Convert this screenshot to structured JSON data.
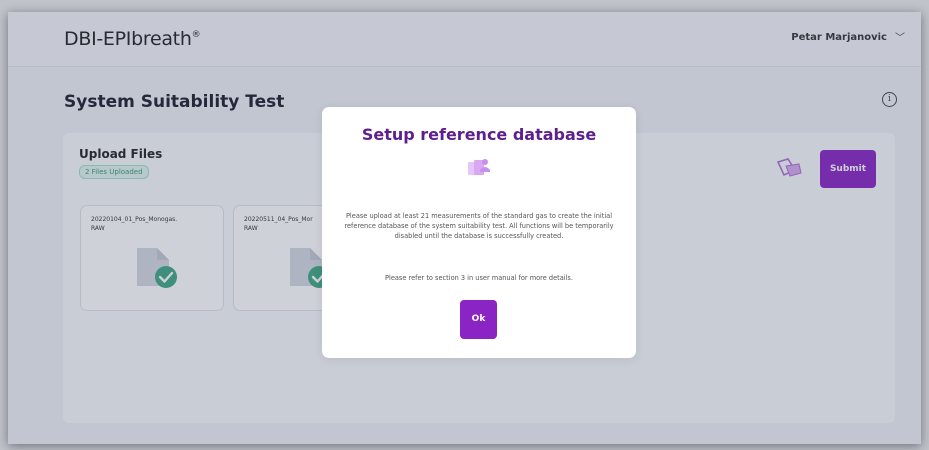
{
  "header": {
    "logo": "DBI-EPIbreath",
    "logo_mark": "®",
    "user_name": "Petar Marjanovic"
  },
  "page": {
    "title": "System Suitability Test"
  },
  "upload": {
    "title": "Upload Files",
    "badge": "2 Files Uploaded",
    "submit_label": "Submit",
    "files": [
      {
        "name": "20220104_01_Pos_Monogas.\nRAW",
        "status": "uploaded"
      },
      {
        "name": "20220511_04_Pos_Mor\nRAW",
        "status": "uploaded"
      }
    ]
  },
  "modal": {
    "title": "Setup reference database",
    "message": "Please upload at least 21 measurements of the standard gas to create the initial reference database of the system suitability test. All functions will be temporarily disabled until the database is successfully created.",
    "reference": "Please refer to section 3 in user manual for more details.",
    "ok_label": "Ok"
  },
  "colors": {
    "accent": "#8a24c4",
    "title_purple": "#5e1f8e",
    "success_green": "#3fa783",
    "icon_purple": "#d9a8f2"
  },
  "icons": {
    "info": "info-icon",
    "chevron": "chevron-down-icon",
    "clear": "eraser-icon",
    "file": "file-icon",
    "check": "check-circle-icon",
    "database_user": "database-user-icon"
  }
}
